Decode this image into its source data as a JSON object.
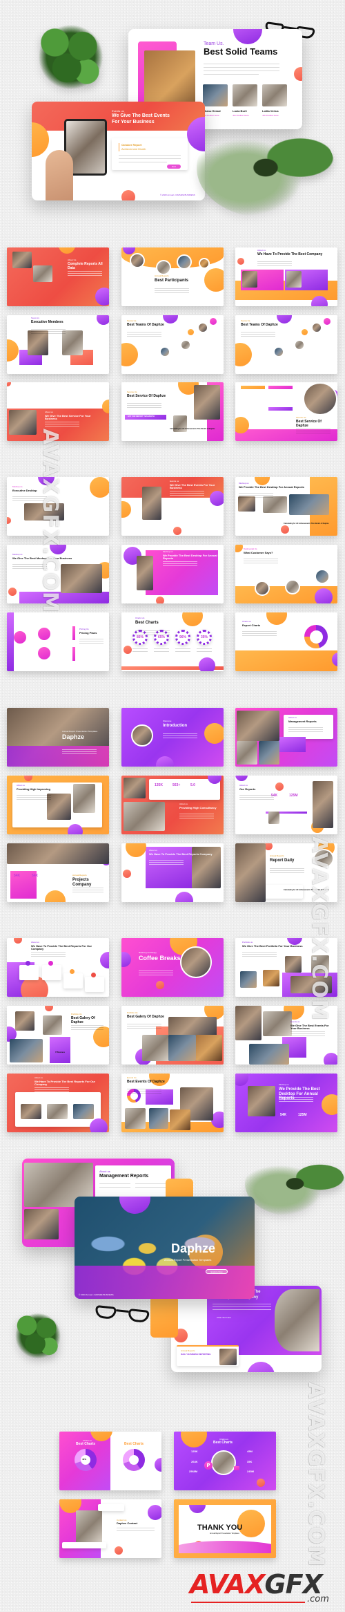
{
  "theme": {
    "accent_purple": "#8e2be2",
    "accent_pink": "#e02ad1",
    "accent_orange": "#ffa13b",
    "accent_coral": "#ee4d43",
    "background": "#eeeeee"
  },
  "hero_top": {
    "team_slide": {
      "kicker": "Team Us.",
      "title": "Best Solid Teams",
      "members": [
        {
          "name": "Bhanu Hemal",
          "role": "Job Position Here"
        },
        {
          "name": "Lucia Burli",
          "role": "Job Position Here"
        },
        {
          "name": "Lolita Verius",
          "role": "Job Position Here"
        }
      ]
    },
    "events_slide": {
      "kicker": "Events us",
      "title_line1": "We Give The Best Events",
      "title_line2": "For Your Business",
      "card_title": "October Report",
      "card_subtitle": "Achievement Month",
      "button": "Next",
      "footer": "© 2023 Annual • DAPHZE BUSINESS"
    }
  },
  "grid_a": [
    {
      "title": "Complete Reports All Data",
      "kicker": "About Us"
    },
    {
      "title": "Best Participants",
      "kicker": "Annual Reports"
    },
    {
      "title": "We Have To Provide The Best Company",
      "kicker": "About us"
    },
    {
      "title": "Executive Members",
      "kicker": "Team Us"
    },
    {
      "title": "Best Teams Of Daphze",
      "kicker": "Teams Us"
    },
    {
      "title": "Best Teams Of Daphze",
      "kicker": "Teams Us"
    },
    {
      "title": "We Give The Best Service For Your Business",
      "kicker": "About us"
    },
    {
      "title": "Best Service Of Daphze",
      "kicker": "Service Us",
      "banner": "LIST FOR REPORT THIS MONTH",
      "card_title": "Calculating for All Achievements This Month of Daphze"
    },
    {
      "title": "Best Service Of Daphze",
      "kicker": "Service Us"
    },
    {
      "title": "Executive Desktop",
      "kicker": "Mockup us"
    },
    {
      "title": "We Give The Best Events For Your Business",
      "kicker": "Events us"
    },
    {
      "title": "We Provide The Best Desktop For Annual Reports",
      "kicker": "Mockup us",
      "card_title": "Calculating for All Achievements This Month of Daphze"
    },
    {
      "title": "We Give The Best Mockup For Your Business",
      "kicker": "Mockup us"
    },
    {
      "title": "We Provide The Best Desktop For Annual Reports",
      "kicker": "Mockup us"
    },
    {
      "title": "What Customer Says?",
      "kicker": "Testimonial Us"
    },
    {
      "title": "Pricing Plans",
      "kicker": "Pricing Us"
    },
    {
      "title": "Best Charts",
      "kicker": "Charts Us",
      "rings": [
        "86%",
        "65%",
        "96%",
        "35%"
      ]
    },
    {
      "title": "Expert Charts",
      "kicker": "Charts us"
    }
  ],
  "grid_b": [
    {
      "title": "Daphze",
      "kicker": "Annual Report Presentation Templates"
    },
    {
      "title": "Introduction",
      "kicker": "Welcome"
    },
    {
      "title": "Management Reports",
      "kicker": "About us"
    },
    {
      "title": "Providing High Improving",
      "kicker": "About us"
    },
    {
      "title": "Providing High Consultancy",
      "kicker": "About us",
      "stats": [
        "135K",
        "563+",
        "5.0"
      ]
    },
    {
      "title": "Our Reports",
      "kicker": "About us",
      "stats": [
        "54K",
        "125M"
      ]
    },
    {
      "title": "Projects Company",
      "kicker": "Annual Reports",
      "stats": [
        "54K",
        "54K"
      ]
    },
    {
      "title": "We Have To Provide The Best Reports Company",
      "kicker": "About us"
    },
    {
      "title": "Report Daily",
      "kicker": "Annual Reports",
      "card_title": "Calculating for All Achievements This Month of Daphze"
    }
  ],
  "grid_c": [
    {
      "title": "We Have To Provide The Best Reports For Our Company",
      "kicker": "About us"
    },
    {
      "title": "Coffee Breaks",
      "kicker": "Relaxing and Enjoy"
    },
    {
      "title": "We Give The Best Portfolio For Your Business",
      "kicker": "Portfolio us"
    },
    {
      "title": "Best Galery Of Daphze",
      "kicker": "Portfolio Us",
      "card_title": "IT Business"
    },
    {
      "title": "Best Galery Of Daphze",
      "kicker": "Portfolio Us"
    },
    {
      "title": "We Give The Best Events For Your Business",
      "kicker": "Events us"
    },
    {
      "title": "We Have To Provide The Best Reports For Our Company",
      "kicker": "About us"
    },
    {
      "title": "Best Events Of Daphze",
      "kicker": "Events Us",
      "stats": [
        "45%"
      ]
    },
    {
      "title": "We Provide The Best Desktop For Annual Reports",
      "kicker": "Mockup us",
      "stats": [
        "54K",
        "125M"
      ]
    }
  ],
  "hero_bottom": {
    "mgmt_slide": {
      "kicker": "About us",
      "title": "Management Reports"
    },
    "cover_slide": {
      "title": "Daphze",
      "subtitle": "Annual Report Presentation Templates",
      "button": "Explore Now",
      "footer": "© 2023 Annual • DAPHZE BUSINESS"
    },
    "reports_slide": {
      "title_line1": "We Have To Provide The",
      "title_line2": "Best Reports Company",
      "card_kicker": "Annual Reports",
      "card_title": "DAILY BUSINESS REPORTING",
      "item": "Chart Text Here"
    }
  },
  "grid_final": [
    {
      "title": "Best Charts",
      "kicker": "Charts us",
      "center": "40%"
    },
    {
      "title": "Best Charts",
      "kicker": "Charts us",
      "stats_left": [
        "125K",
        "264K",
        "2568M"
      ],
      "stats_right": [
        "45M",
        "35K",
        "245M"
      ]
    },
    {
      "title": "Daphze Contact",
      "kicker": "Contact us"
    },
    {
      "title": "THANK YOU",
      "kicker": "Annual Report Presentation Templates"
    }
  ],
  "watermarks": {
    "left_vertical": "AVAXGFX.COM",
    "right_vertical": "AVAXGFX.COM"
  },
  "logo": {
    "part1": "AVAX",
    "part2": "GFX",
    "suffix": ".com"
  }
}
